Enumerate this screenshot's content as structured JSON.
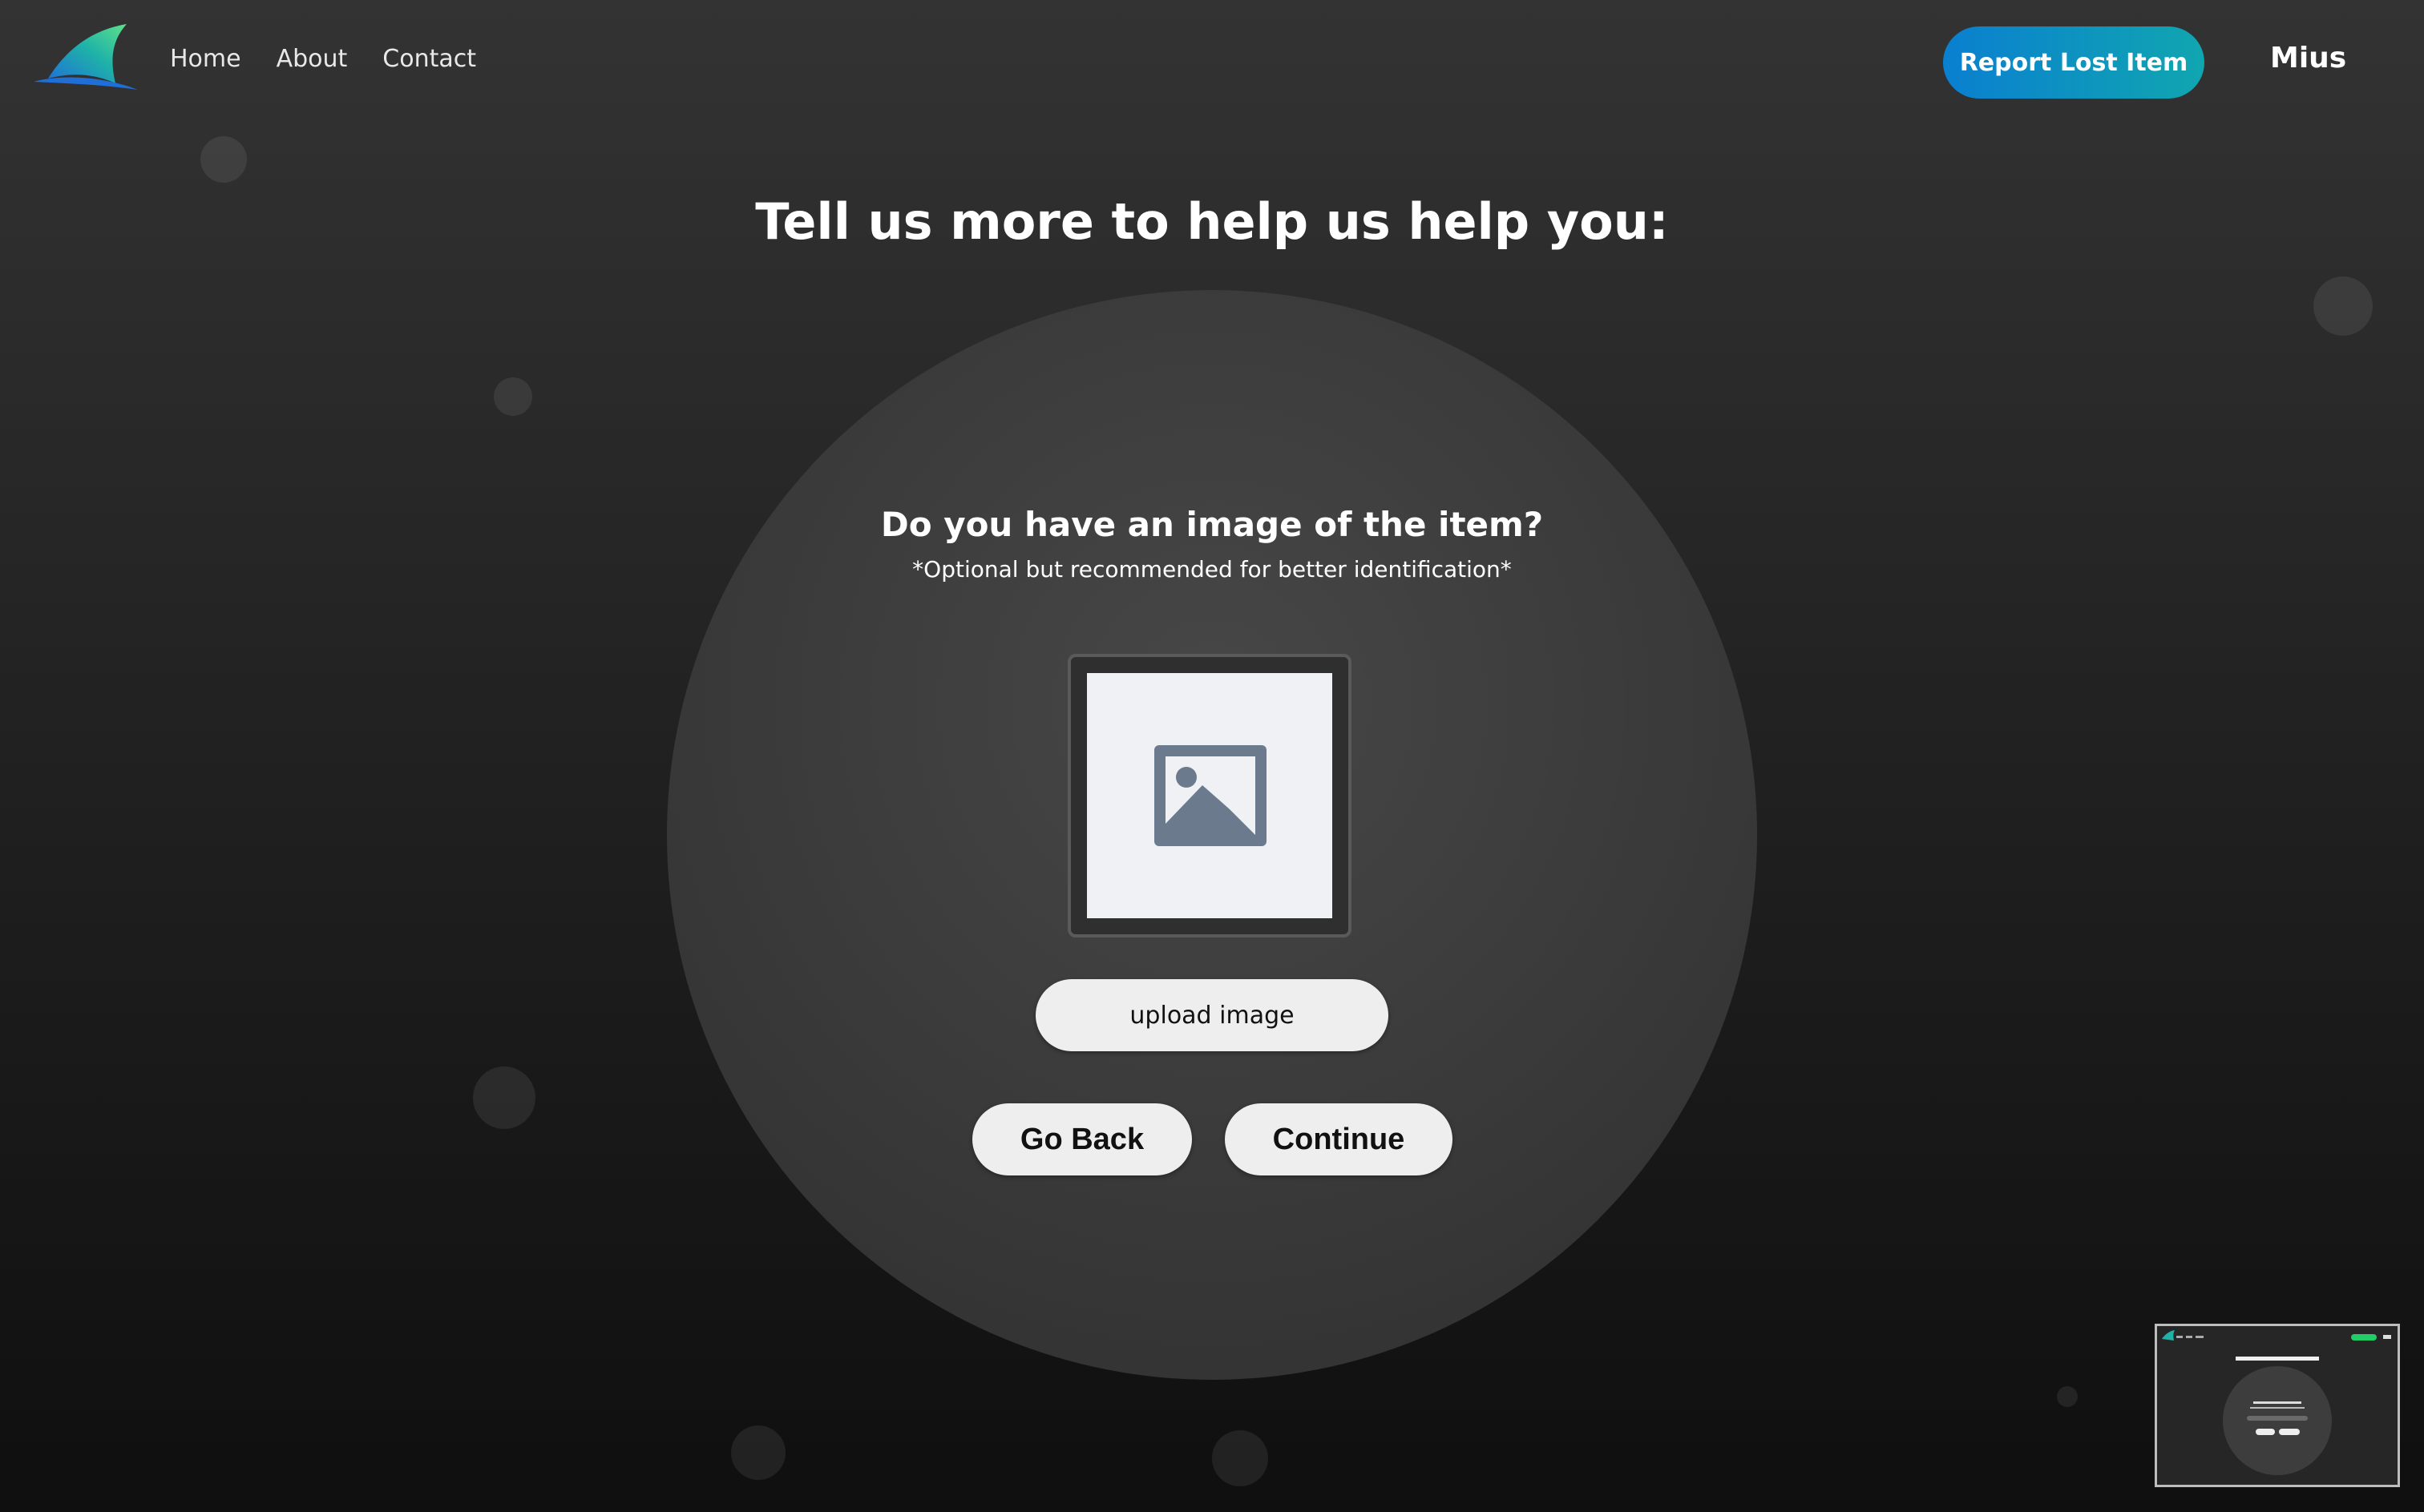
{
  "nav": {
    "logo_icon": "shark-fin-logo-icon",
    "links": [
      {
        "label": "Home"
      },
      {
        "label": "About"
      },
      {
        "label": "Contact"
      }
    ],
    "report_button": "Report Lost Item",
    "username": "Mius"
  },
  "main": {
    "title": "Tell us more to help us help you:",
    "question": "Do you have an image of the item?",
    "hint": "*Optional but recommended for better identification*",
    "image_placeholder_icon": "image-placeholder-icon",
    "upload_button": "upload image",
    "back_button": "Go Back",
    "continue_button": "Continue"
  },
  "minimap": {
    "icon": "page-thumbnail"
  },
  "colors": {
    "accent_gradient_start": "#0a7fd0",
    "accent_gradient_end": "#10a6b0",
    "button_bg": "#eeeeee",
    "placeholder_bg": "#eff1f5",
    "placeholder_icon": "#6b7a8c"
  }
}
